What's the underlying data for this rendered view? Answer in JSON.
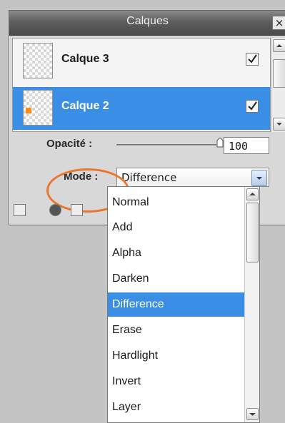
{
  "panel": {
    "title": "Calques"
  },
  "layers": [
    {
      "name": "Calque 3",
      "visible": true,
      "selected": false
    },
    {
      "name": "Calque 2",
      "visible": true,
      "selected": true
    }
  ],
  "opacity": {
    "label": "Opacité :",
    "value": "100"
  },
  "mode": {
    "label": "Mode :",
    "value": "Difference",
    "options": [
      "Normal",
      "Add",
      "Alpha",
      "Darken",
      "Difference",
      "Erase",
      "Hardlight",
      "Invert",
      "Layer"
    ],
    "selected_index": 4
  },
  "colors": {
    "selection": "#3a8ee6",
    "highlight_ring": "#e9762b",
    "titlebar": "#5e5e5e"
  },
  "icons": {
    "close": "close-icon",
    "visibility": "checkbox-icon",
    "dropdown": "chevron-down-icon"
  }
}
